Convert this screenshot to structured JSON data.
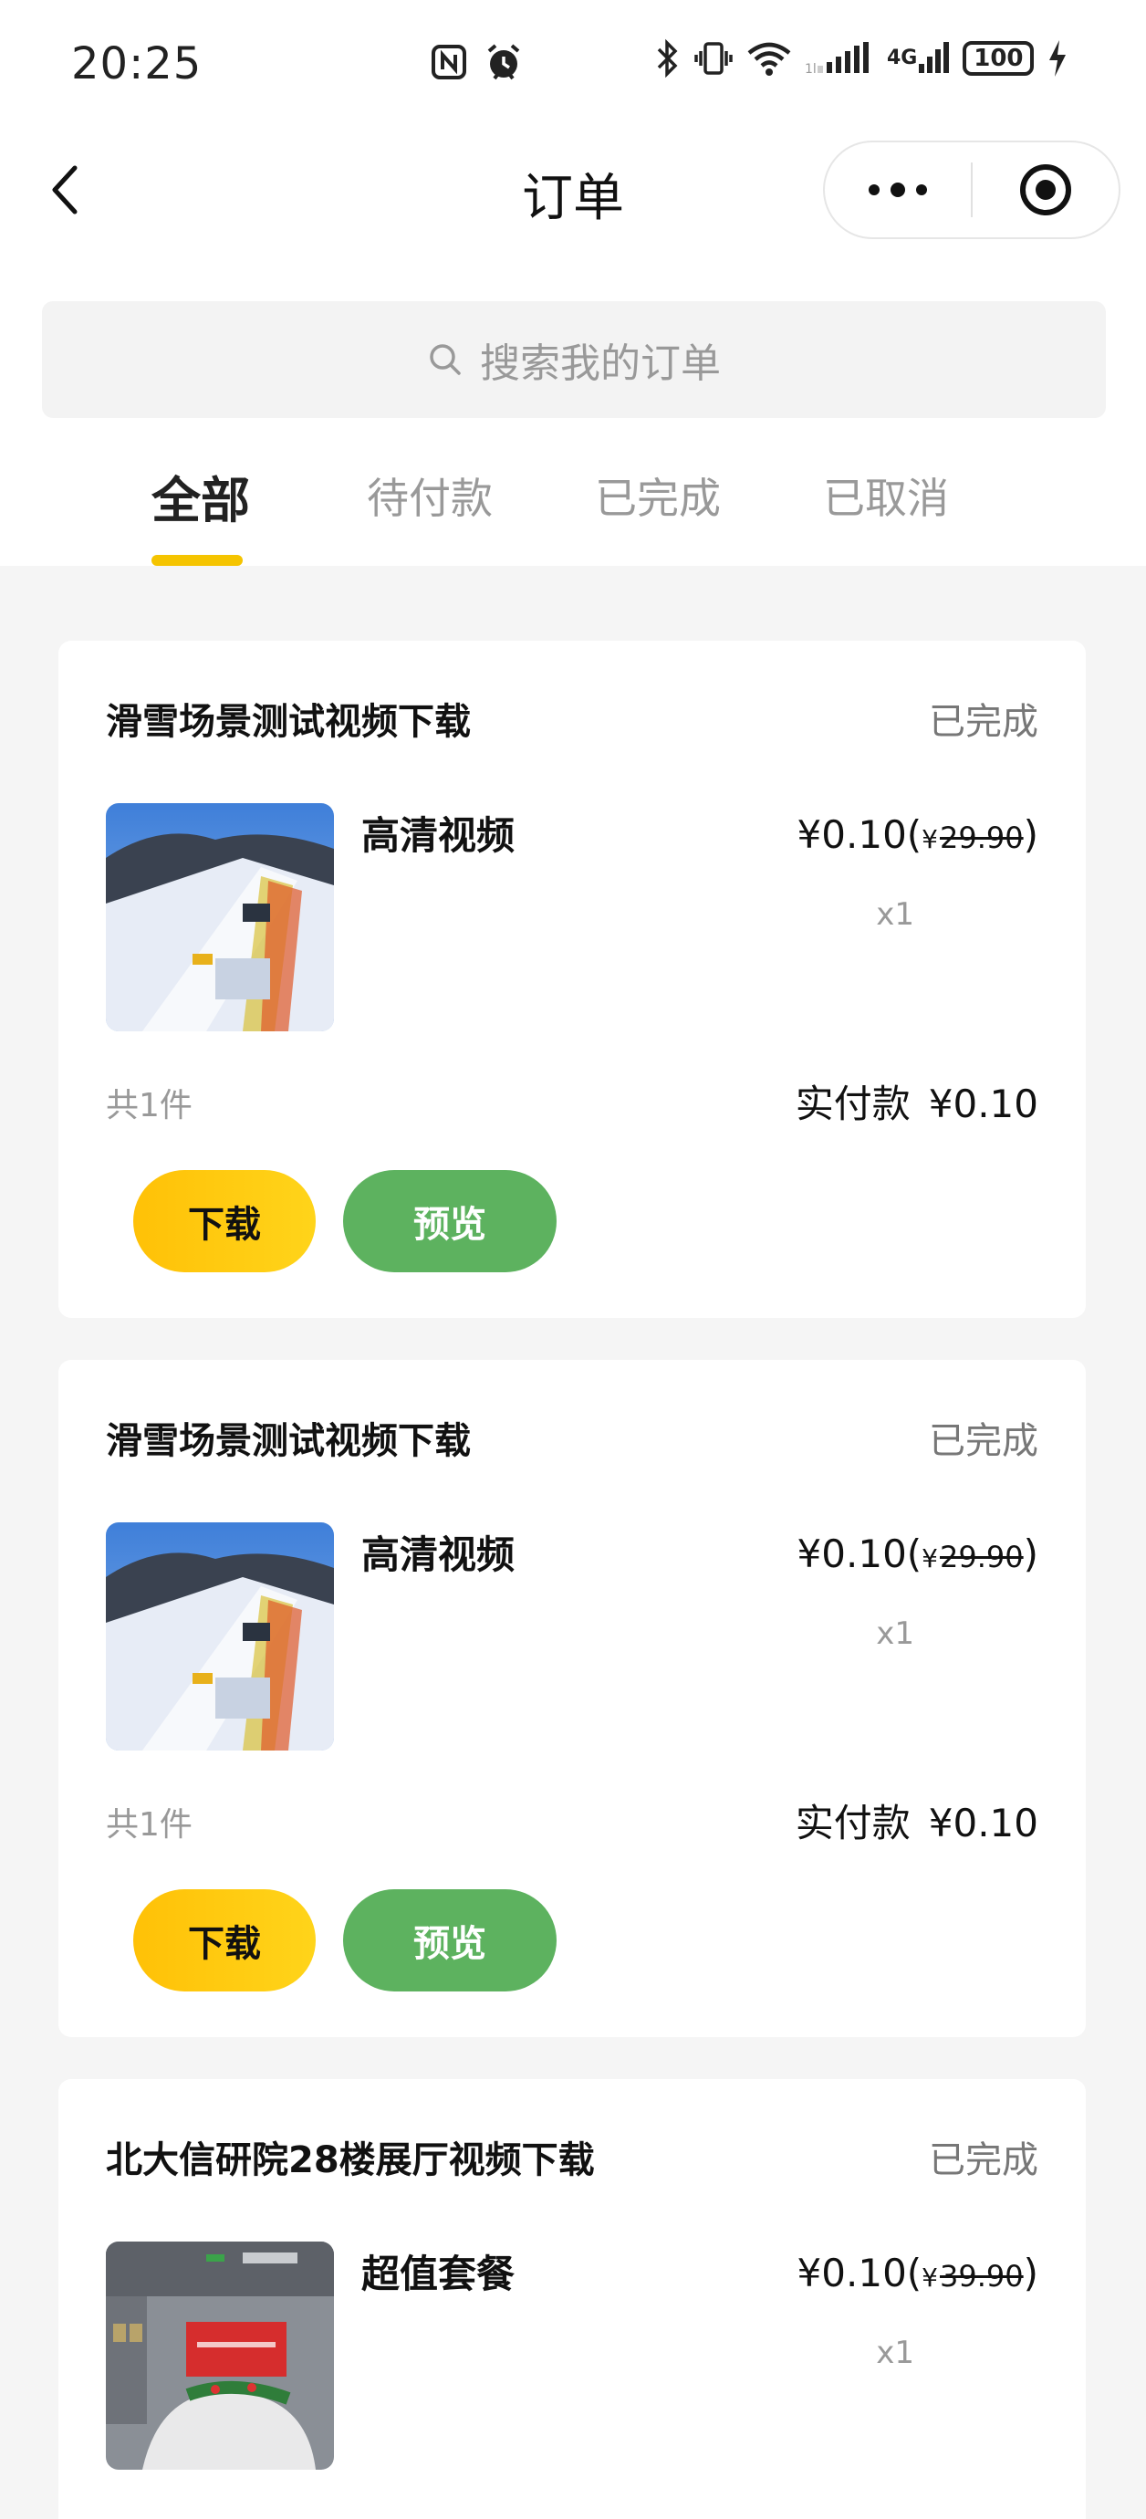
{
  "status_bar": {
    "time": "20:25",
    "battery": "100",
    "network": "4G",
    "icons": [
      "nfc-icon",
      "alarm-icon",
      "bluetooth-icon",
      "vibrate-icon",
      "wifi-icon",
      "signal-icon",
      "signal-4g-icon",
      "battery-icon",
      "charging-icon"
    ]
  },
  "nav": {
    "title": "订单",
    "back_icon": "chevron-left-icon",
    "more_icon": "more-dots-icon",
    "close_icon": "target-close-icon"
  },
  "search": {
    "placeholder": "搜索我的订单",
    "icon": "search-icon"
  },
  "tabs": [
    {
      "label": "全部",
      "active": true
    },
    {
      "label": "待付款",
      "active": false
    },
    {
      "label": "已完成",
      "active": false
    },
    {
      "label": "已取消",
      "active": false
    }
  ],
  "colors": {
    "accent_yellow": "#f5c400",
    "preview_green": "#5db25f",
    "page_bg": "#f5f5f5"
  },
  "orders": [
    {
      "title": "滑雪场景测试视频下载",
      "status": "已完成",
      "item_name": "高清视频",
      "price": "0.10",
      "price_open": "¥0.10(",
      "original_price_prefix": "¥",
      "original_price": "29.90",
      "price_close": ")",
      "quantity": "x1",
      "count": "共1件",
      "paid_label": "实付款",
      "paid_amount": "¥0.10",
      "download_label": "下载",
      "preview_label": "预览",
      "thumbnail": "ski-slope-photo"
    },
    {
      "title": "滑雪场景测试视频下载",
      "status": "已完成",
      "item_name": "高清视频",
      "price": "0.10",
      "price_open": "¥0.10(",
      "original_price_prefix": "¥",
      "original_price": "29.90",
      "price_close": ")",
      "quantity": "x1",
      "count": "共1件",
      "paid_label": "实付款",
      "paid_amount": "¥0.10",
      "download_label": "下载",
      "preview_label": "预览",
      "thumbnail": "ski-slope-photo"
    },
    {
      "title": "北大信研院28楼展厅视频下载",
      "status": "已完成",
      "item_name": "超值套餐",
      "price": "0.10",
      "price_open": "¥0.10(",
      "original_price_prefix": "¥",
      "original_price": "39.90",
      "price_close": ")",
      "quantity": "x1",
      "thumbnail": "exhibition-hall-photo"
    }
  ]
}
